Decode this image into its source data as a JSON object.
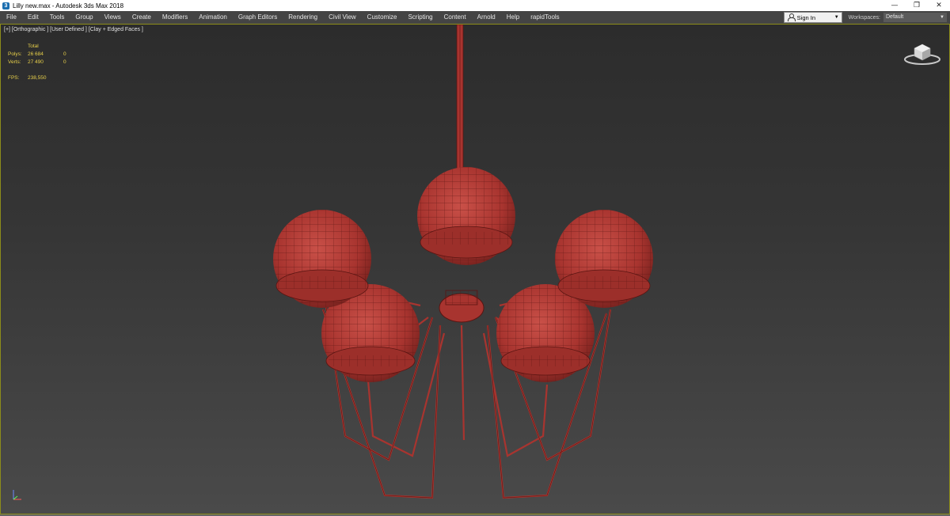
{
  "window": {
    "title": "Lilly new.max - Autodesk 3ds Max 2018",
    "minimize": "—",
    "restore": "❐",
    "close": "✕"
  },
  "menu": {
    "items": [
      "File",
      "Edit",
      "Tools",
      "Group",
      "Views",
      "Create",
      "Modifiers",
      "Animation",
      "Graph Editors",
      "Rendering",
      "Civil View",
      "Customize",
      "Scripting",
      "Content",
      "Arnold",
      "Help",
      "rapidTools"
    ],
    "sign_in": "Sign In",
    "workspaces_label": "Workspaces:",
    "workspace_value": "Default"
  },
  "viewport": {
    "label": "[+] [Orthographic ] [User Defined ] [Clay + Edged Faces ]",
    "stats": {
      "total_header": "Total",
      "polys_label": "Polys:",
      "polys_total": "26 684",
      "polys_selected": "0",
      "verts_label": "Verts:",
      "verts_total": "27 490",
      "verts_selected": "0",
      "fps_label": "FPS:",
      "fps_value": "238,550"
    }
  },
  "colors": {
    "model_fill": "#b03a34",
    "model_wire": "#5a1512",
    "stats_text": "#e8d04a"
  },
  "icons": {
    "app": "3ds-max-icon",
    "viewcube": "viewcube-icon",
    "axis": "axis-tripod-icon",
    "user": "user-icon"
  }
}
